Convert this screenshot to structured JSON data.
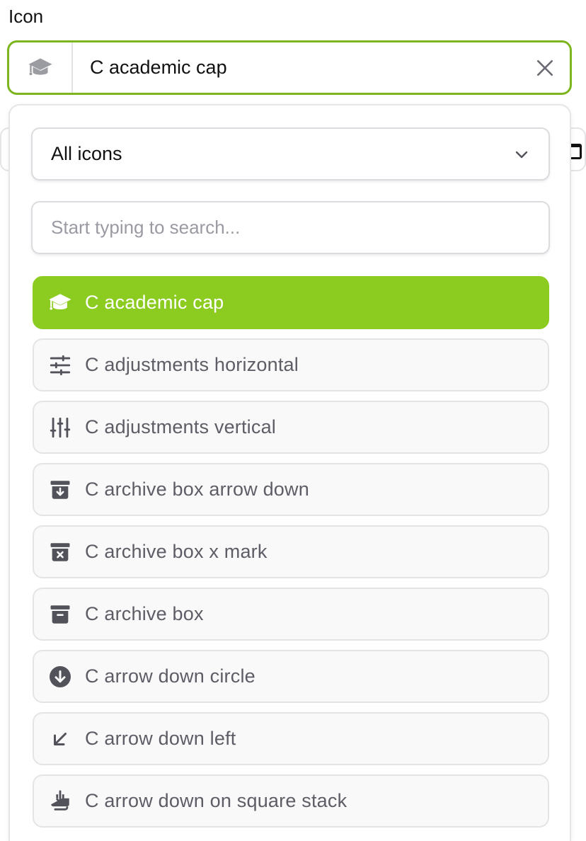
{
  "field": {
    "label": "Icon",
    "value": "C academic cap",
    "prefix_icon": "academic-cap-icon",
    "clear_icon": "close-icon"
  },
  "dropdown": {
    "category_select": {
      "value": "All icons",
      "icon": "chevron-down-icon"
    },
    "search": {
      "placeholder": "Start typing to search..."
    },
    "options": [
      {
        "label": "C academic cap",
        "icon": "academic-cap-icon",
        "selected": true
      },
      {
        "label": "C adjustments horizontal",
        "icon": "adjustments-horizontal-icon",
        "selected": false
      },
      {
        "label": "C adjustments vertical",
        "icon": "adjustments-vertical-icon",
        "selected": false
      },
      {
        "label": "C archive box arrow down",
        "icon": "archive-box-arrow-down-icon",
        "selected": false
      },
      {
        "label": "C archive box x mark",
        "icon": "archive-box-x-mark-icon",
        "selected": false
      },
      {
        "label": "C archive box",
        "icon": "archive-box-icon",
        "selected": false
      },
      {
        "label": "C arrow down circle",
        "icon": "arrow-down-circle-icon",
        "selected": false
      },
      {
        "label": "C arrow down left",
        "icon": "arrow-down-left-icon",
        "selected": false
      },
      {
        "label": "C arrow down on square stack",
        "icon": "arrow-down-on-square-stack-icon",
        "selected": false
      }
    ]
  },
  "colors": {
    "accent": "#8ccc21",
    "focus_border": "#7cb51e",
    "icon_gray": "#52525b",
    "text_muted": "#5d5d66"
  }
}
